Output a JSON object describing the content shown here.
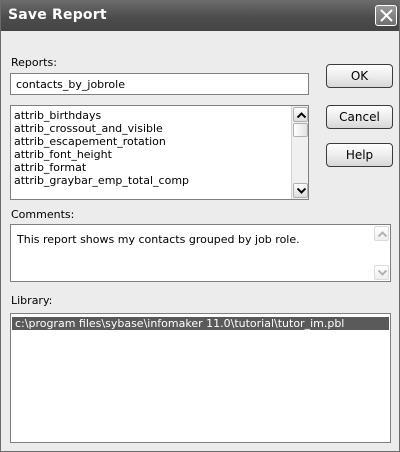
{
  "window": {
    "title": "Save Report",
    "close_icon": "close-x-icon"
  },
  "reports": {
    "label": "Reports:",
    "value": "contacts_by_jobrole",
    "items": [
      "attrib_birthdays",
      "attrib_crossout_and_visible",
      "attrib_escapement_rotation",
      "attrib_font_height",
      "attrib_format",
      "attrib_graybar_emp_total_comp"
    ]
  },
  "buttons": {
    "ok": "OK",
    "cancel": "Cancel",
    "help": "Help"
  },
  "comments": {
    "label": "Comments:",
    "value": "This report shows my contacts grouped by job role."
  },
  "library": {
    "label": "Library:",
    "items": [
      "c:\\program files\\sybase\\infomaker 11.0\\tutorial\\tutor_im.pbl"
    ],
    "selected_index": 0
  },
  "colors": {
    "titlebar": "#4c4c4c",
    "dialog_bg": "#ececec",
    "selection": "#5a5a5a"
  }
}
